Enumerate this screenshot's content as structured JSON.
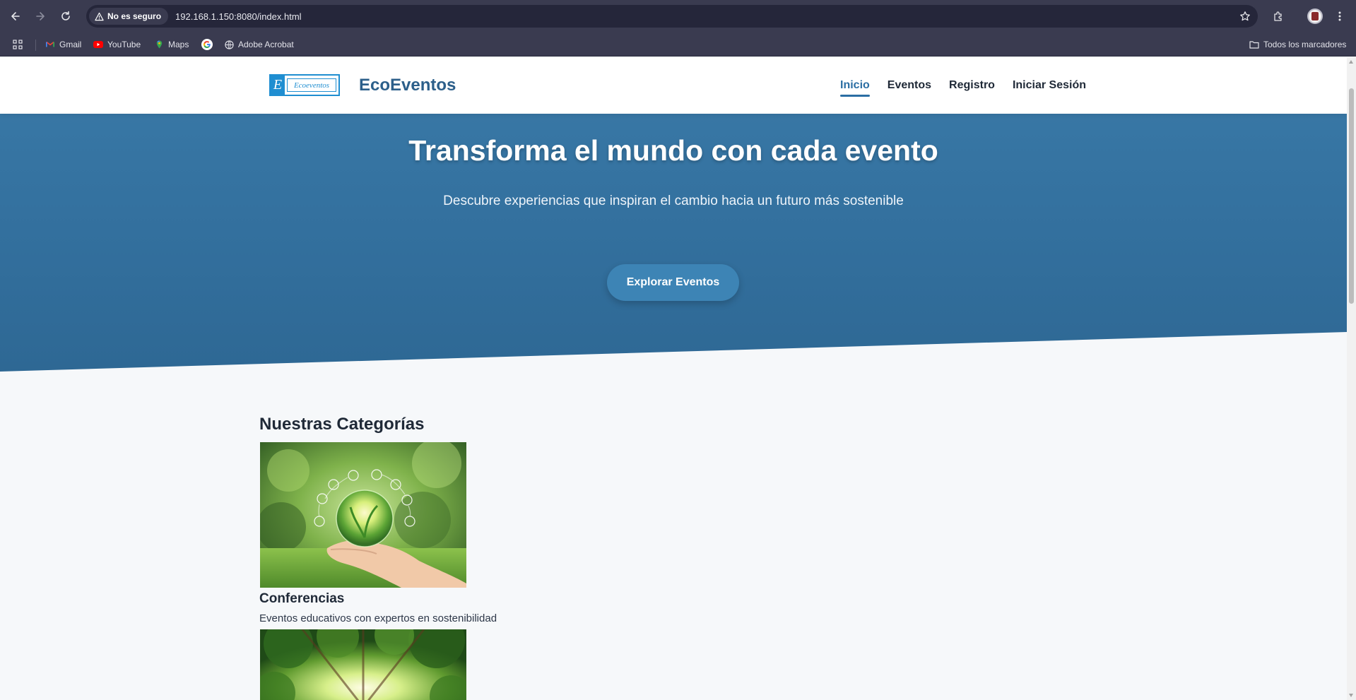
{
  "browser": {
    "security_label": "No es seguro",
    "url": "192.168.1.150:8080/index.html",
    "bookmarks": [
      {
        "label": "Gmail",
        "icon": "gmail-icon"
      },
      {
        "label": "YouTube",
        "icon": "youtube-icon"
      },
      {
        "label": "Maps",
        "icon": "maps-icon"
      },
      {
        "label": "",
        "icon": "google-icon"
      },
      {
        "label": "Adobe Acrobat",
        "icon": "acrobat-icon"
      }
    ],
    "all_bookmarks_label": "Todos los marcadores"
  },
  "site": {
    "logo_text": "Ecoeventos",
    "logo_letter": "E",
    "brand": "EcoEventos",
    "nav": [
      {
        "label": "Inicio",
        "active": true
      },
      {
        "label": "Eventos",
        "active": false
      },
      {
        "label": "Registro",
        "active": false
      },
      {
        "label": "Iniciar Sesión",
        "active": false
      }
    ]
  },
  "hero": {
    "title": "Transforma el mundo con cada evento",
    "subtitle": "Descubre experiencias que inspiran el cambio hacia un futuro más sostenible",
    "cta": "Explorar Eventos"
  },
  "categories": {
    "title": "Nuestras Categorías",
    "items": [
      {
        "title": "Conferencias",
        "description": "Eventos educativos con expertos en sostenibilidad"
      }
    ]
  },
  "colors": {
    "brand_blue": "#2c5f8a",
    "hero_blue": "#3a7aa8",
    "cta_blue": "#3d84b5",
    "page_bg": "#f6f8fa"
  }
}
